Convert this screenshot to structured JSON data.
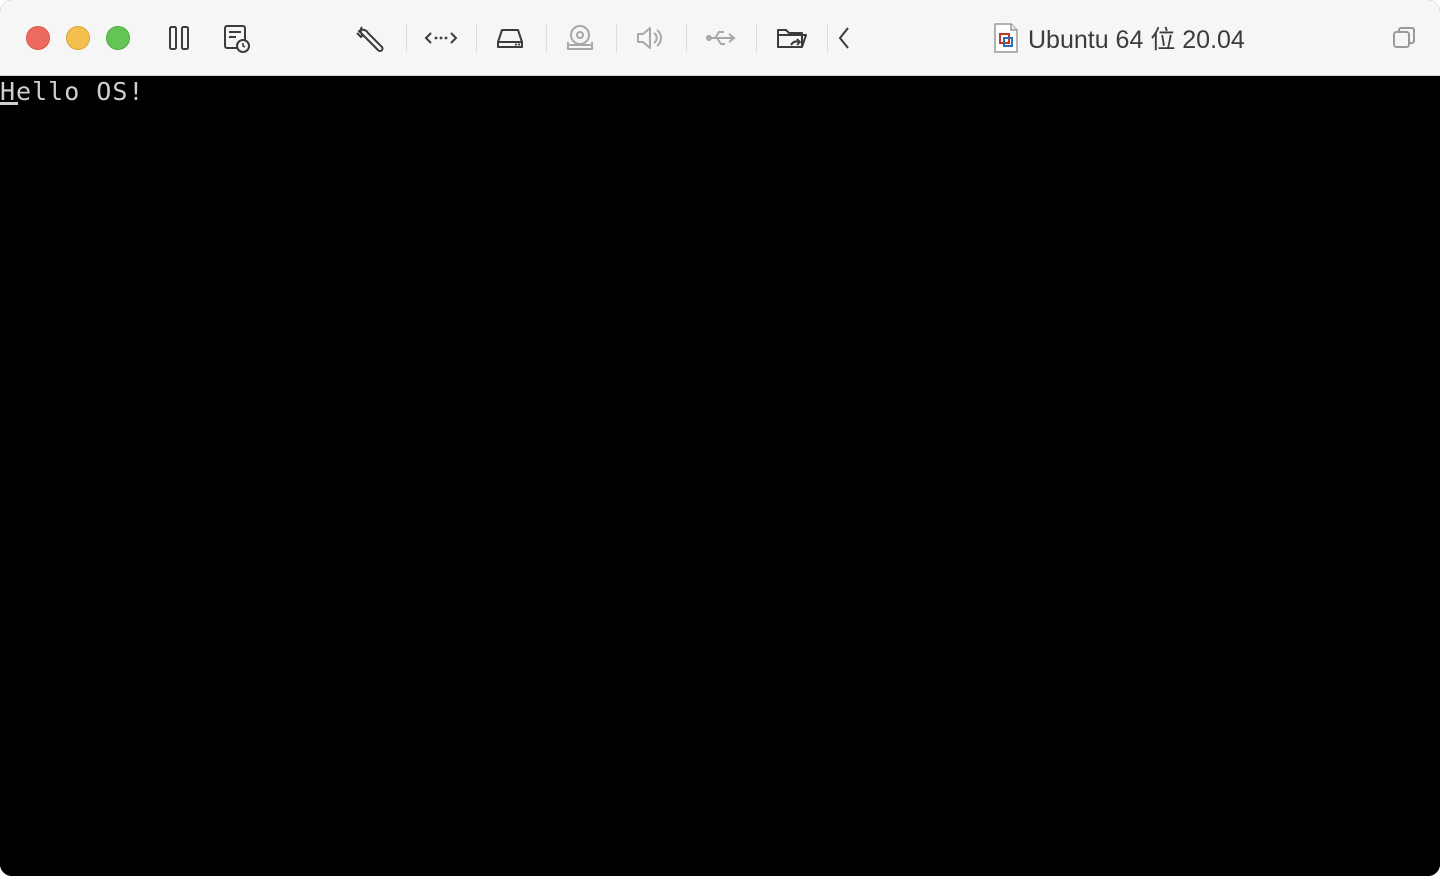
{
  "window": {
    "title": "Ubuntu 64 位 20.04"
  },
  "toolbar": {
    "icons": [
      "pause-icon",
      "snapshot-icon",
      "settings-wrench-icon",
      "network-icon",
      "hard-disk-icon",
      "optical-drive-icon",
      "sound-icon",
      "usb-icon",
      "shared-folder-icon",
      "collapse-chevron-icon",
      "window-restore-icon"
    ]
  },
  "console": {
    "line1": "Hello OS!"
  },
  "colors": {
    "close": "#ed6a5e",
    "minimize": "#f5bf4f",
    "maximize": "#62c554",
    "console_bg": "#000000",
    "console_text": "#cfcfcf"
  }
}
